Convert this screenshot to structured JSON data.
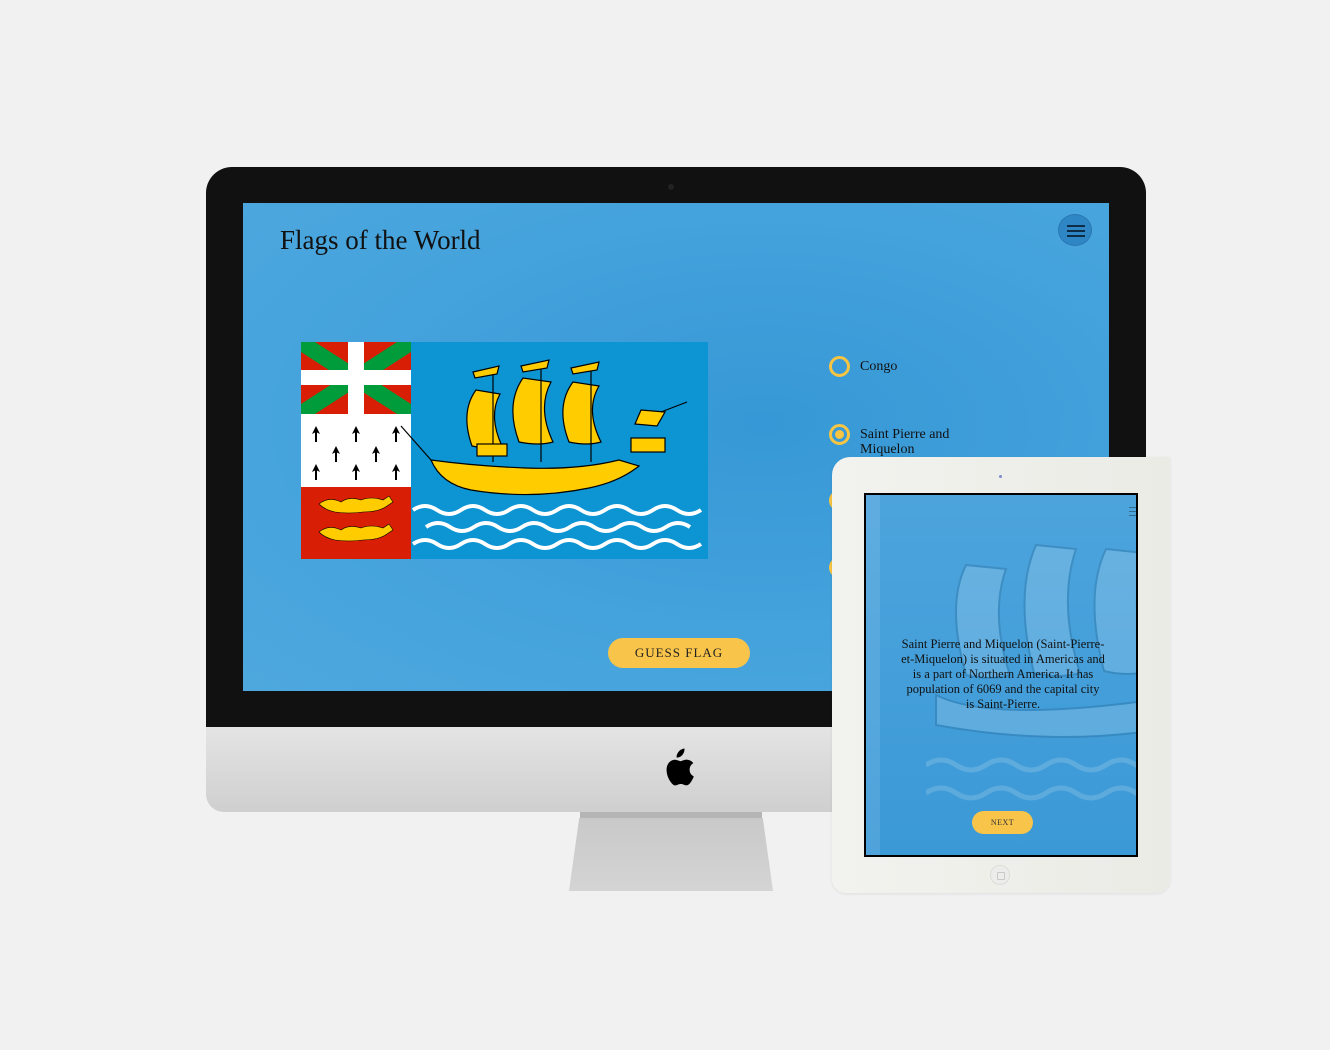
{
  "app": {
    "title": "Flags of the World"
  },
  "quiz": {
    "options": [
      {
        "label": "Congo",
        "selected": false
      },
      {
        "label": "Saint Pierre and Miquelon",
        "selected": true
      },
      {
        "label": "",
        "selected": false
      },
      {
        "label": "",
        "selected": false
      }
    ],
    "guess_button_label": "GUESS FLAG"
  },
  "tablet": {
    "info_text": "Saint Pierre and Miquelon (Saint-Pierre-et-Miquelon) is situated in Americas and is a part of Northern America. It has population of 6069 and the capital city is Saint-Pierre.",
    "next_button_label": "NEXT"
  },
  "colors": {
    "screen_blue": "#44a2dc",
    "accent_yellow": "#f9c44a",
    "flag_blue": "#0d94d2",
    "flag_gold": "#ffcc00",
    "flag_red": "#d81e05",
    "flag_green": "#009b3a"
  },
  "icons": {
    "menu": "hamburger-icon",
    "device_logo": "apple-logo",
    "radio": "radio-icon"
  }
}
